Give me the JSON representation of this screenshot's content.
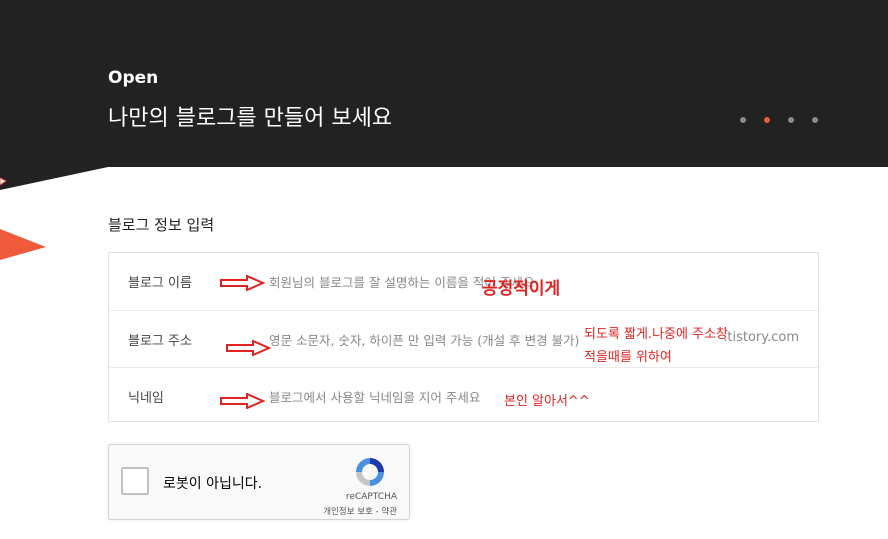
{
  "hero": {
    "label": "Open",
    "title": "나만의 블로그를 만들어 보세요",
    "slider_total": 4,
    "slider_active": 2,
    "background": "#222222",
    "accent": "#f05a3c"
  },
  "form": {
    "section_title": "블로그 정보 입력",
    "rows": [
      {
        "label": "블로그 이름",
        "placeholder": "회원님의 블로그를 잘 설명하는 이름을 적어 주세요",
        "suffix": ""
      },
      {
        "label": "블로그 주소",
        "placeholder": "영문 소문자, 숫자, 하이픈 만 입력 가능 (개설 후 변경 불가)",
        "suffix": ".tistory.com"
      },
      {
        "label": "닉네임",
        "placeholder": "블로그에서 사용할 닉네임을 지어 주세요",
        "suffix": ""
      }
    ]
  },
  "annotations": {
    "color": "#e02323",
    "name_note": "공정적이게",
    "address_note_line1": "되도록 짧게.나중에 주소창",
    "address_note_line2": "적을때를 위하여",
    "nickname_note": "본인 알아서^^"
  },
  "captcha": {
    "label": "로봇이 아닙니다.",
    "brand": "reCAPTCHA",
    "privacy": "개인정보 보호",
    "separator": " - ",
    "terms": "약관"
  }
}
